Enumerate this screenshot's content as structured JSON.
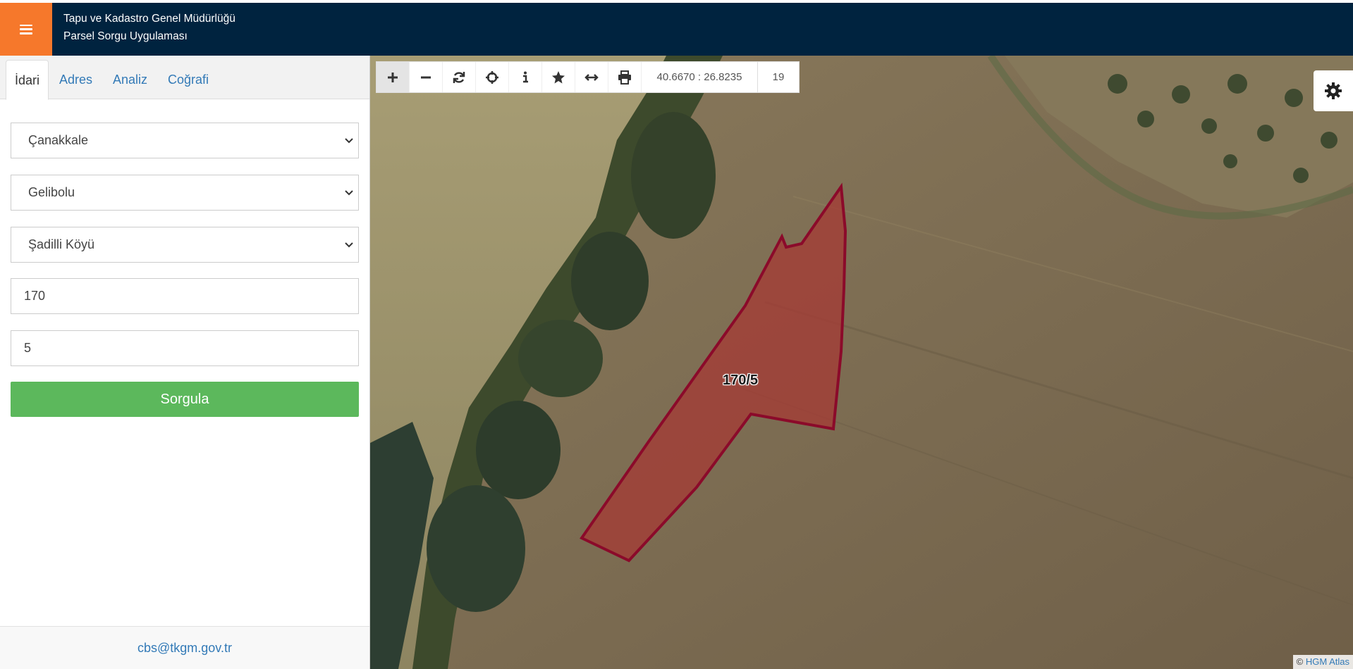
{
  "header": {
    "title_line1": "Tapu ve Kadastro Genel Müdürlüğü",
    "title_line2": "Parsel Sorgu Uygulaması",
    "menu_icon": "hamburger-icon",
    "accent_color": "#f6782b",
    "bar_color": "#00233f"
  },
  "sidebar": {
    "tabs": [
      {
        "label": "İdari",
        "active": true
      },
      {
        "label": "Adres",
        "active": false
      },
      {
        "label": "Analiz",
        "active": false
      },
      {
        "label": "Coğrafi",
        "active": false
      }
    ],
    "form": {
      "il": "Çanakkale",
      "ilce": "Gelibolu",
      "mahalle": "Şadilli Köyü",
      "ada": "170",
      "parsel": "5"
    },
    "submit_label": "Sorgula",
    "submit_color": "#5cb85c",
    "footer_email": "cbs@tkgm.gov.tr"
  },
  "map": {
    "toolbar": {
      "buttons": [
        "zoom-in-icon",
        "zoom-out-icon",
        "refresh-icon",
        "locate-icon",
        "info-icon",
        "star-icon",
        "measure-icon",
        "print-icon"
      ],
      "coordinates": "40.6670 : 26.8235",
      "zoom": "19"
    },
    "settings_icon": "gear-icon",
    "parcel_label": "170/5",
    "parcel_color": "#8b0a2a",
    "attribution_prefix": "©",
    "attribution_link": "HGM Atlas"
  }
}
